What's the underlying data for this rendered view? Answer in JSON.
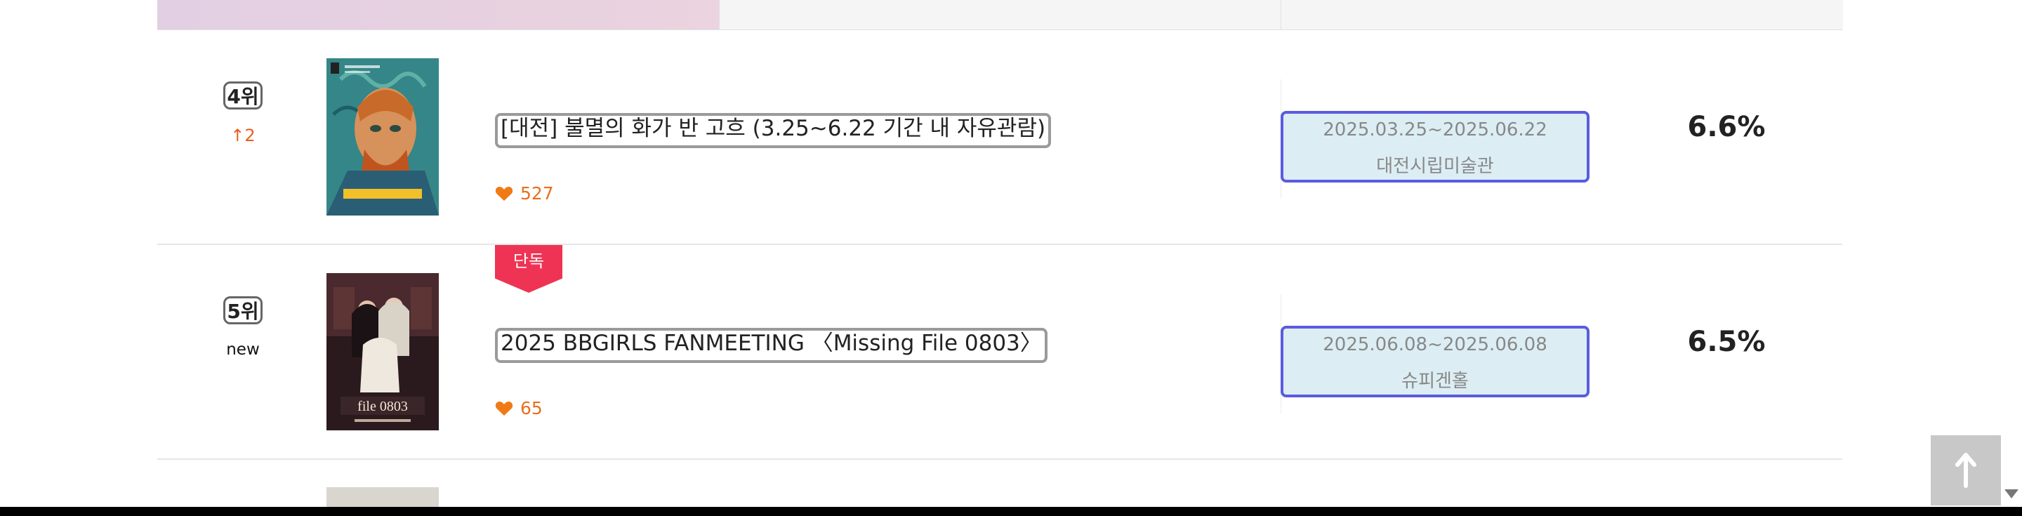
{
  "rows": [
    {
      "rank": "4위",
      "change": "↑2",
      "change_type": "up",
      "exclusive": "",
      "title": "[대전] 불멸의 화가 반 고흐 (3.25~6.22 기간 내 자유관람)",
      "likes": "527",
      "date_range": "2025.03.25~2025.06.22",
      "venue": "대전시립미술관",
      "share": "6.6%",
      "poster_icon": "van-gogh-portrait-poster"
    },
    {
      "rank": "5위",
      "change": "new",
      "change_type": "new",
      "exclusive": "단독",
      "title": "2025 BBGIRLS FANMEETING 〈Missing File 0803〉",
      "likes": "65",
      "date_range": "2025.06.08~2025.06.08",
      "venue": "슈피겐홀",
      "share": "6.5%",
      "poster_icon": "bbgirls-fanmeeting-poster"
    }
  ],
  "scroll_top_button": {
    "icon": "arrow-up-icon"
  },
  "colors": {
    "accent_orange": "#e86f1e",
    "exclusive_badge": "#ef3354",
    "info_box_bg": "#dceef4",
    "info_box_border": "#5b5be0"
  }
}
